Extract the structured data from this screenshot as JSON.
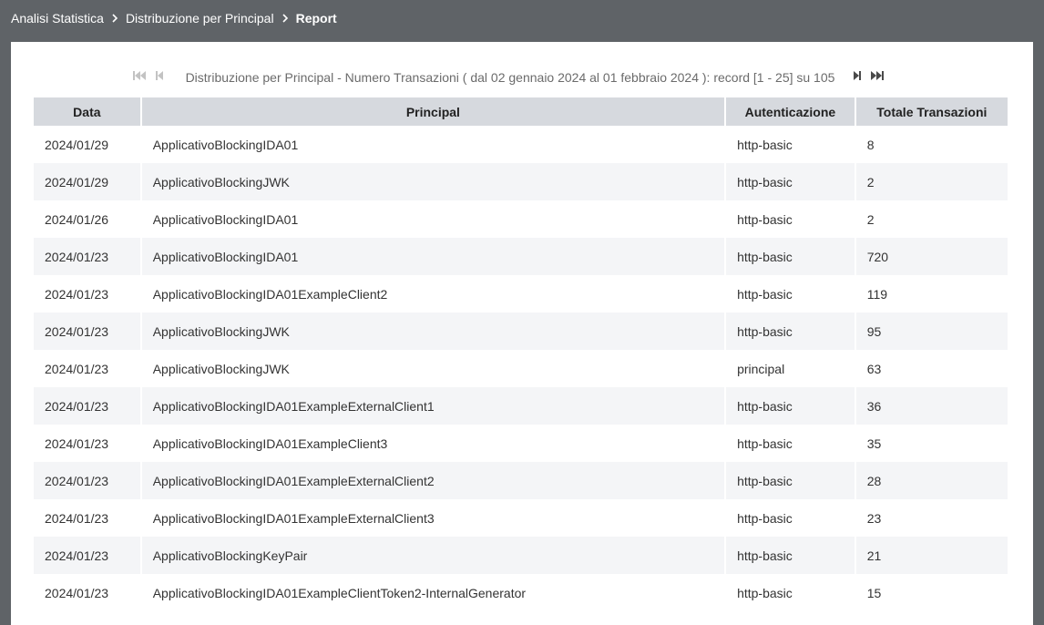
{
  "breadcrumb": {
    "items": [
      "Analisi Statistica",
      "Distribuzione per Principal"
    ],
    "current": "Report"
  },
  "pager": {
    "text": "Distribuzione per Principal - Numero Transazioni ( dal 02 gennaio 2024 al 01 febbraio 2024 ): record [1 - 25] su 105"
  },
  "table": {
    "headers": [
      "Data",
      "Principal",
      "Autenticazione",
      "Totale Transazioni"
    ],
    "rows": [
      [
        "2024/01/29",
        "ApplicativoBlockingIDA01",
        "http-basic",
        "8"
      ],
      [
        "2024/01/29",
        "ApplicativoBlockingJWK",
        "http-basic",
        "2"
      ],
      [
        "2024/01/26",
        "ApplicativoBlockingIDA01",
        "http-basic",
        "2"
      ],
      [
        "2024/01/23",
        "ApplicativoBlockingIDA01",
        "http-basic",
        "720"
      ],
      [
        "2024/01/23",
        "ApplicativoBlockingIDA01ExampleClient2",
        "http-basic",
        "119"
      ],
      [
        "2024/01/23",
        "ApplicativoBlockingJWK",
        "http-basic",
        "95"
      ],
      [
        "2024/01/23",
        "ApplicativoBlockingJWK",
        "principal",
        "63"
      ],
      [
        "2024/01/23",
        "ApplicativoBlockingIDA01ExampleExternalClient1",
        "http-basic",
        "36"
      ],
      [
        "2024/01/23",
        "ApplicativoBlockingIDA01ExampleClient3",
        "http-basic",
        "35"
      ],
      [
        "2024/01/23",
        "ApplicativoBlockingIDA01ExampleExternalClient2",
        "http-basic",
        "28"
      ],
      [
        "2024/01/23",
        "ApplicativoBlockingIDA01ExampleExternalClient3",
        "http-basic",
        "23"
      ],
      [
        "2024/01/23",
        "ApplicativoBlockingKeyPair",
        "http-basic",
        "21"
      ],
      [
        "2024/01/23",
        "ApplicativoBlockingIDA01ExampleClientToken2-InternalGenerator",
        "http-basic",
        "15"
      ]
    ]
  }
}
